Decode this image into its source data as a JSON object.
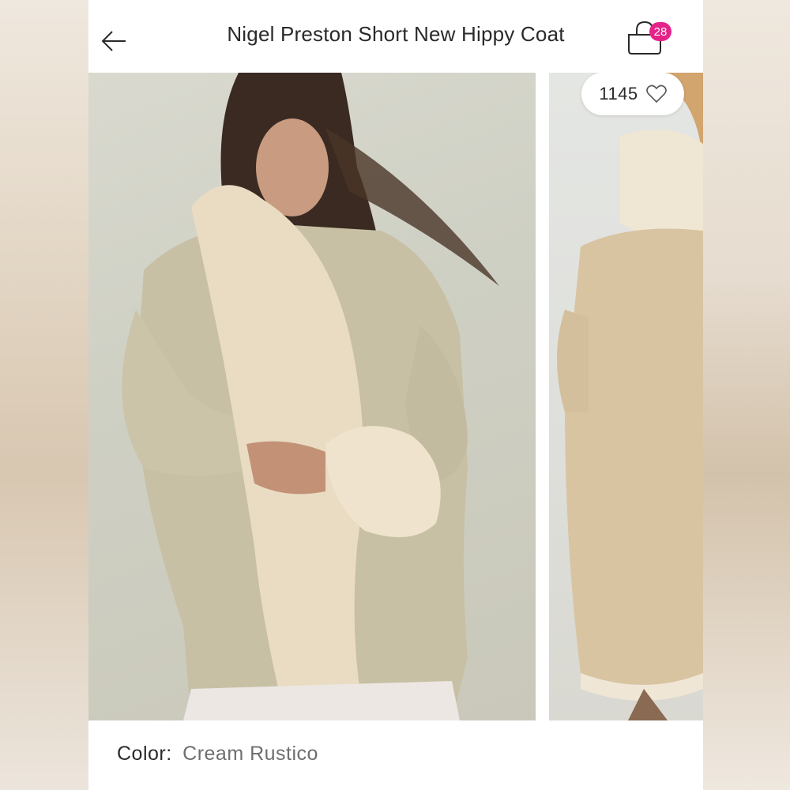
{
  "header": {
    "title": "Nigel Preston Short New Hippy Coat",
    "back_icon": "arrow-left-icon",
    "cart_icon": "shopping-bag-icon",
    "cart_count": "28"
  },
  "gallery": {
    "like_count": "1145",
    "like_icon": "heart-outline-icon",
    "images": [
      "main-product-photo",
      "back-view-photo"
    ]
  },
  "details": {
    "color_label": "Color:",
    "color_value": "Cream Rustico"
  },
  "colors": {
    "badge": "#e5218a",
    "title_text": "#2a2a2a",
    "secondary_text": "#6e6e6e"
  }
}
